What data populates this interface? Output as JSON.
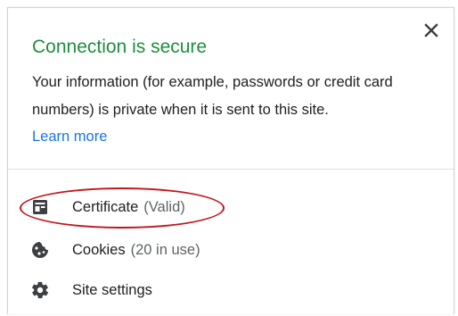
{
  "popup": {
    "title": "Connection is secure",
    "description": "Your information (for example, passwords or credit card numbers) is private when it is sent to this site.",
    "learn_more": "Learn more",
    "close_icon": "close-icon"
  },
  "menu": {
    "certificate": {
      "label": "Certificate",
      "status": "(Valid)",
      "icon": "certificate-icon"
    },
    "cookies": {
      "label": "Cookies",
      "status": "(20 in use)",
      "icon": "cookie-icon"
    },
    "site_settings": {
      "label": "Site settings",
      "icon": "gear-icon"
    }
  },
  "colors": {
    "title_green": "#1e8e3e",
    "link_blue": "#1a73e8",
    "annotation_red": "#c0181f"
  }
}
